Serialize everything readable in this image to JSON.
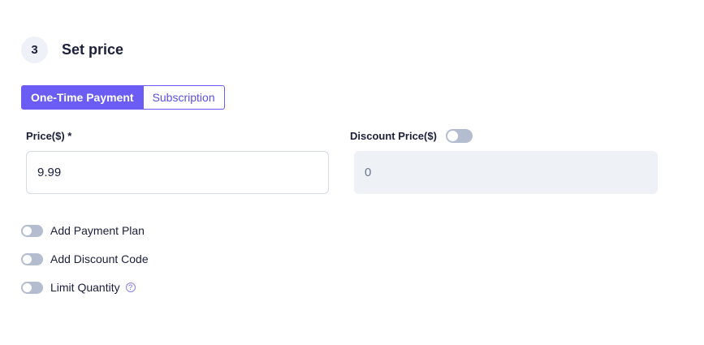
{
  "step": {
    "number": "3",
    "title": "Set price"
  },
  "tabs": [
    {
      "label": "One-Time Payment",
      "active": true
    },
    {
      "label": "Subscription",
      "active": false
    }
  ],
  "price": {
    "label": "Price($) *",
    "value": "9.99"
  },
  "discount": {
    "label": "Discount Price($)",
    "placeholder": "0",
    "enabled": false
  },
  "options": [
    {
      "label": "Add Payment Plan",
      "enabled": false
    },
    {
      "label": "Add Discount Code",
      "enabled": false
    },
    {
      "label": "Limit Quantity",
      "enabled": false,
      "help_icon": "question-mark-icon"
    }
  ],
  "help_glyph": "?",
  "colors": {
    "accent": "#6a5cf5",
    "toggle_off": "#b4bccf",
    "disabled_field": "#eef1f6"
  }
}
